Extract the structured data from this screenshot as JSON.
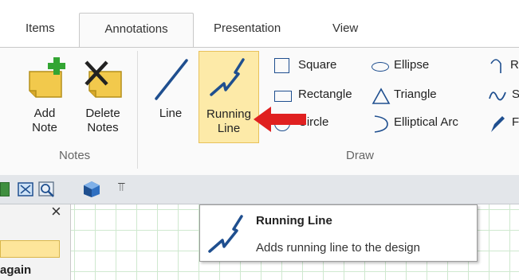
{
  "tabs": [
    {
      "label": "Items"
    },
    {
      "label": "Annotations",
      "active": true
    },
    {
      "label": "Presentation"
    },
    {
      "label": "View"
    }
  ],
  "ribbon": {
    "notes_group": {
      "add_note": [
        "Add",
        "Note"
      ],
      "delete_notes": [
        "Delete",
        "Notes"
      ],
      "label": "Notes"
    },
    "draw_group": {
      "line": "Line",
      "running_line": [
        "Running",
        "Line"
      ],
      "square": "Square",
      "rectangle": "Rectangle",
      "circle": "Circle",
      "ellipse": "Ellipse",
      "triangle": "Triangle",
      "elliptical_arc": "Elliptical Arc",
      "cut_r": "R",
      "cut_s": "S",
      "cut_f": "F",
      "label": "Draw"
    }
  },
  "quickbar": {
    "overflow": "⫪"
  },
  "left_panel": {
    "close": "×",
    "item_text": "again"
  },
  "tooltip": {
    "title": "Running Line",
    "description": "Adds running line to the design"
  },
  "colors": {
    "accent_highlight": "#fdeaa8",
    "arrow": "#e02020",
    "icon_blue": "#1f4f8f",
    "note_yellow": "#f2c94c",
    "add_green": "#33a533"
  }
}
